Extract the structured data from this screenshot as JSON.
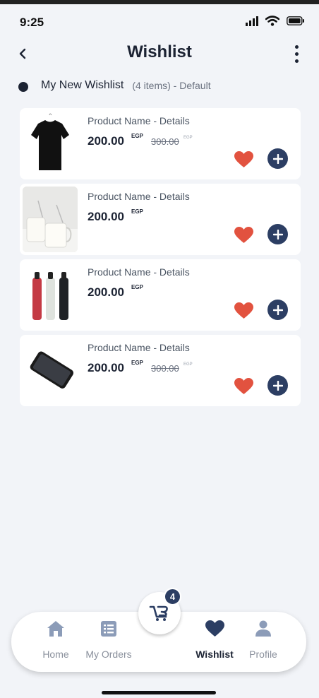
{
  "status": {
    "time": "9:25"
  },
  "header": {
    "title": "Wishlist"
  },
  "wishlist": {
    "name": "My New Wishlist",
    "meta": "(4 items) - Default"
  },
  "products": [
    {
      "name": "Product Name - Details",
      "price": "200.00",
      "currency": "EGP",
      "old_price": "300.00",
      "old_currency": "EGP",
      "image": "t-shirt"
    },
    {
      "name": "Product Name - Details",
      "price": "200.00",
      "currency": "EGP",
      "old_price": "",
      "old_currency": "",
      "image": "milk-jars"
    },
    {
      "name": "Product Name - Details",
      "price": "200.00",
      "currency": "EGP",
      "old_price": "",
      "old_currency": "",
      "image": "bottles"
    },
    {
      "name": "Product Name - Details",
      "price": "200.00",
      "currency": "EGP",
      "old_price": "300.00",
      "old_currency": "EGP",
      "image": "smartphone"
    }
  ],
  "nav": {
    "home": "Home",
    "orders": "My Orders",
    "wishlist": "Wishlist",
    "profile": "Profile",
    "cart_count": "4"
  },
  "colors": {
    "accent": "#2c3e63",
    "heart": "#e2523f",
    "background": "#f2f4f8"
  }
}
